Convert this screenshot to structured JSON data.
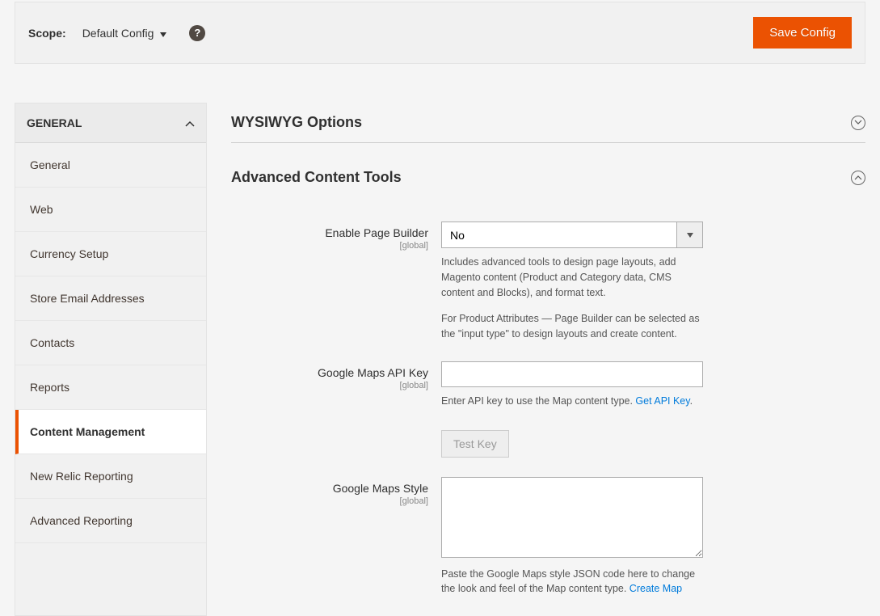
{
  "header": {
    "scope_label": "Scope:",
    "scope_value": "Default Config",
    "save_label": "Save Config"
  },
  "sidebar": {
    "section_title": "GENERAL",
    "items": [
      {
        "label": "General"
      },
      {
        "label": "Web"
      },
      {
        "label": "Currency Setup"
      },
      {
        "label": "Store Email Addresses"
      },
      {
        "label": "Contacts"
      },
      {
        "label": "Reports"
      },
      {
        "label": "Content Management"
      },
      {
        "label": "New Relic Reporting"
      },
      {
        "label": "Advanced Reporting"
      }
    ]
  },
  "sections": {
    "wysiwyg": {
      "title": "WYSIWYG Options"
    },
    "advanced": {
      "title": "Advanced Content Tools",
      "fields": {
        "enable_pagebuilder": {
          "label": "Enable Page Builder",
          "scope": "[global]",
          "value": "No",
          "note1": "Includes advanced tools to design page layouts, add Magento content (Product and Category data, CMS content and Blocks), and format text.",
          "note2": "For Product Attributes — Page Builder can be selected as the \"input type\" to design layouts and create content."
        },
        "maps_api_key": {
          "label": "Google Maps API Key",
          "scope": "[global]",
          "value": "",
          "note": "Enter API key to use the Map content type. ",
          "link": "Get API Key",
          "test_btn": "Test Key"
        },
        "maps_style": {
          "label": "Google Maps Style",
          "scope": "[global]",
          "value": "",
          "note": "Paste the Google Maps style JSON code here to change the look and feel of the Map content type. ",
          "link": "Create Map"
        }
      }
    }
  }
}
